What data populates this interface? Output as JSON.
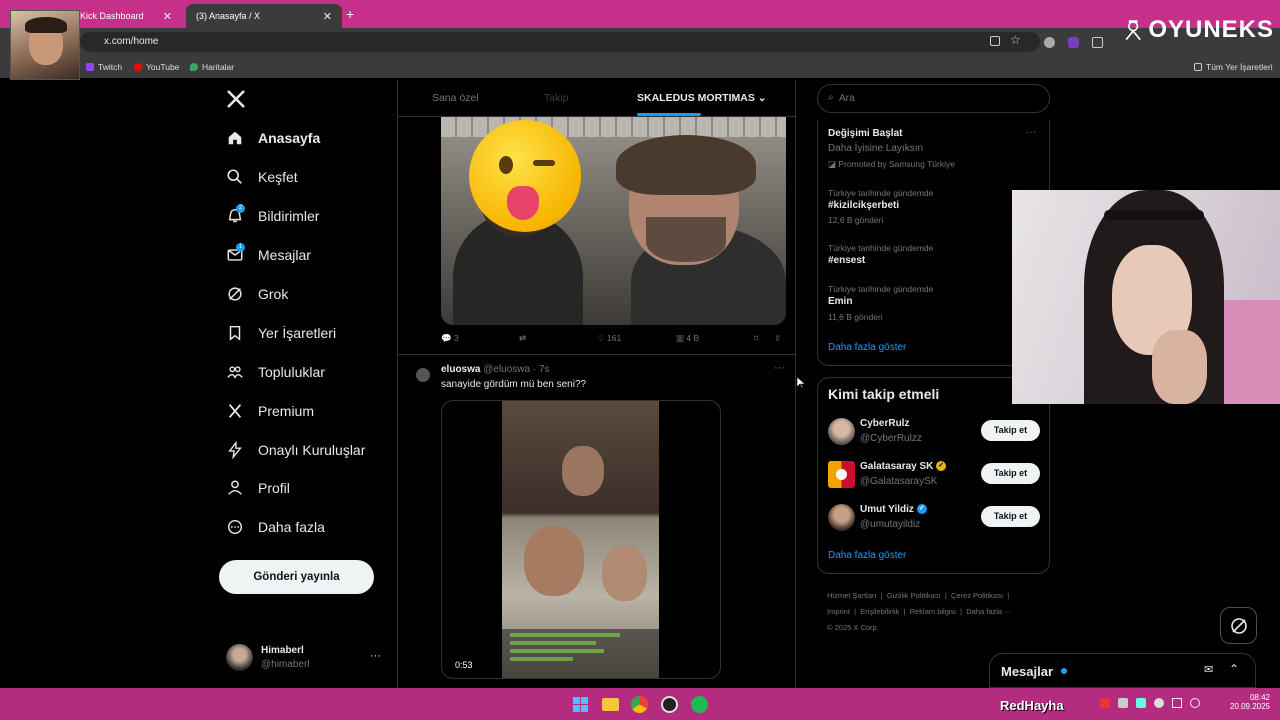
{
  "browser": {
    "tabs": [
      {
        "label": "Kick Dashboard"
      },
      {
        "label": "(3) Anasayfa / X"
      }
    ],
    "url": "x.com/home",
    "bookmarks": [
      {
        "label": "Twitch",
        "color": "#9146ff"
      },
      {
        "label": "YouTube",
        "color": "#ff0000"
      },
      {
        "label": "Haritalar",
        "color": "#34a853"
      }
    ],
    "all_bookmarks": "Tüm Yer İşaretleri",
    "overlay_brand": "OYUNEKS"
  },
  "nav": {
    "items": [
      {
        "label": "Anasayfa",
        "icon": "home-icon",
        "active": true
      },
      {
        "label": "Keşfet",
        "icon": "search-icon"
      },
      {
        "label": "Bildirimler",
        "icon": "bell-icon",
        "badge": "2"
      },
      {
        "label": "Mesajlar",
        "icon": "mail-icon",
        "badge": "1"
      },
      {
        "label": "Grok",
        "icon": "grok-icon"
      },
      {
        "label": "Yer İşaretleri",
        "icon": "bookmark-icon"
      },
      {
        "label": "Topluluklar",
        "icon": "communities-icon"
      },
      {
        "label": "Premium",
        "icon": "x-logo-icon"
      },
      {
        "label": "Onaylı Kuruluşlar",
        "icon": "lightning-icon"
      },
      {
        "label": "Profil",
        "icon": "person-icon"
      },
      {
        "label": "Daha fazla",
        "icon": "more-circle-icon"
      }
    ],
    "post_button": "Gönderi yayınla",
    "account": {
      "name": "Himaberl",
      "handle": "@himaberl"
    }
  },
  "feed": {
    "tabs": [
      "Sana özel",
      "Takip",
      "SKALEDUS MORTIMAS"
    ],
    "first_post_actions": {
      "replies": "3",
      "likes": "161",
      "views": "4 B"
    },
    "post": {
      "name": "eluoswa",
      "handle": "@eluoswa",
      "time": "· 7s",
      "text": "sanayide gördüm mü ben seni??",
      "video_time": "0:53"
    }
  },
  "right": {
    "search_placeholder": "Ara",
    "promo": {
      "title": "Değişimi Başlat",
      "subtitle": "Daha İyisine Layıksın",
      "promoted": "Promoted by Samsung Türkiye"
    },
    "trends": [
      {
        "context": "Türkiye tarihinde gündemde",
        "name": "#kizilcikşerbeti",
        "count": "12,6 B gönderi"
      },
      {
        "context": "Türkiye tarihinde gündemde",
        "name": "#ensest",
        "count": ""
      },
      {
        "context": "Türkiye tarihinde gündemde",
        "name": "Emin",
        "count": "11,6 B gönderi"
      }
    ],
    "show_more": "Daha fazla göster",
    "who_to_follow": {
      "title": "Kimi takip etmeli",
      "users": [
        {
          "name": "CyberRulz",
          "handle": "@CyberRulzz",
          "verified": ""
        },
        {
          "name": "Galatasaray SK",
          "handle": "@GalatasaraySK",
          "verified": "gold"
        },
        {
          "name": "Umut Yildiz",
          "handle": "@umutayildiz",
          "verified": "blue"
        }
      ],
      "follow_label": "Takip et",
      "show_more": "Daha fazla göster"
    },
    "footer": {
      "links": [
        "Hizmet Şartları",
        "Gizlilik Politikası",
        "Çerez Politikası",
        "Imprint",
        "Erişilebilirlik",
        "Reklam bilgisi",
        "Daha fazla ···"
      ],
      "copyright": "© 2025 X Corp."
    },
    "messages_drawer": "Mesajlar"
  },
  "taskbar": {
    "overlay_name": "RedHayha",
    "time": "08:42",
    "date": "20.09.2025"
  }
}
